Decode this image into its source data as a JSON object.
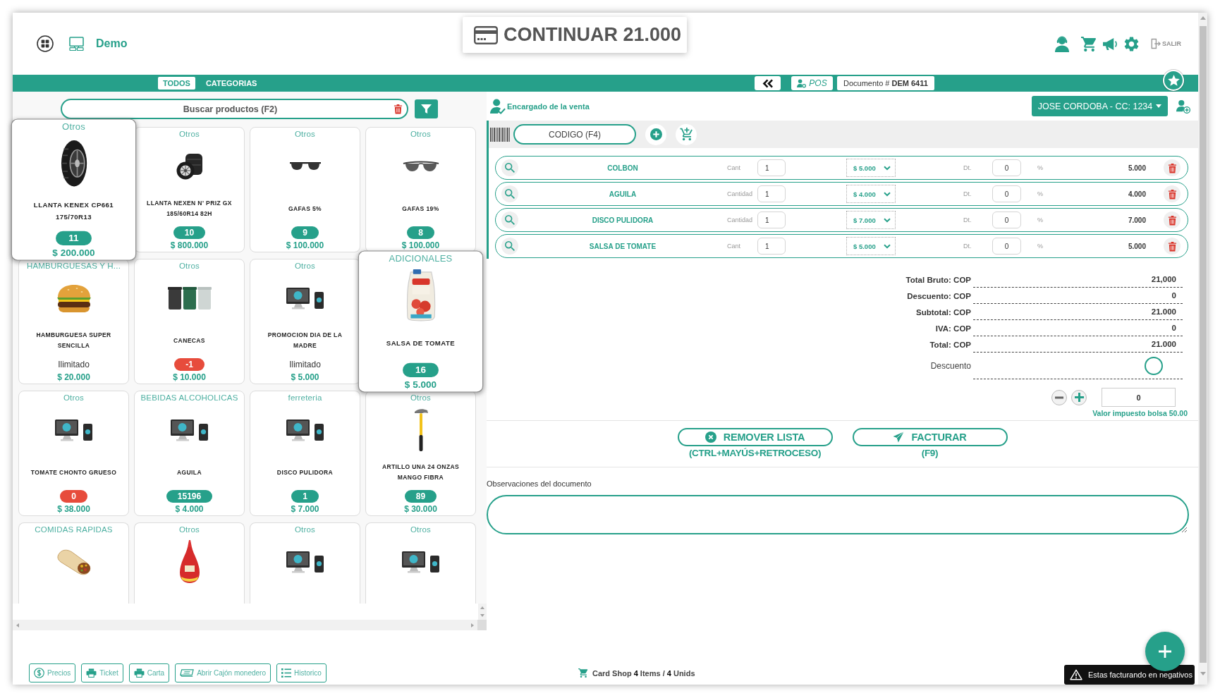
{
  "header": {
    "brand": "Demo",
    "checkout": "CONTINUAR 21.000",
    "logout": {
      "label": "SALIR",
      "disabled": true
    }
  },
  "nav": {
    "tabs": [
      {
        "label": "TODOS",
        "selected": true
      },
      {
        "label": "CATEGORIAS",
        "selected": false
      }
    ],
    "mode": "POS",
    "document": "Documento # **DEM 6411**"
  },
  "search": {
    "placeholder": "Buscar productos (F2)"
  },
  "products": [
    {
      "category": "Otros",
      "kind": "tire",
      "name": "LLANTA KENEX CP661 175/70R13",
      "stock": {
        "kind": "badge",
        "value": "11",
        "color": "#26a08a"
      },
      "price": "$ 200.000",
      "raised": true
    },
    {
      "category": "Otros",
      "kind": "wheel",
      "name": "LLANTA NEXEN N' PRIZ GX 185/60R14 82H",
      "stock": {
        "kind": "badge",
        "value": "10",
        "color": "#26a08a"
      },
      "price": "$ 800.000",
      "raised": false
    },
    {
      "category": "Otros",
      "kind": "sunglasses",
      "name": "GAFAS 5%",
      "stock": {
        "kind": "badge",
        "value": "9",
        "color": "#26a08a"
      },
      "price": "$ 100.000",
      "raised": false
    },
    {
      "category": "Otros",
      "kind": "sportglasses",
      "name": "GAFAS 19%",
      "stock": {
        "kind": "badge",
        "value": "8",
        "color": "#26a08a"
      },
      "price": "$ 100.000",
      "raised": false
    },
    {
      "category": "HAMBURGUESAS Y H...",
      "kind": "burger",
      "name": "HAMBURGUESA SUPER SENCILLA",
      "stock": {
        "kind": "text",
        "value": "Ilimitado"
      },
      "price": "$ 20.000",
      "raised": false
    },
    {
      "category": "Otros",
      "kind": "bins",
      "name": "CANECAS",
      "stock": {
        "kind": "badge",
        "value": "-1",
        "color": "#e74c3c"
      },
      "price": "$ 10.000",
      "raised": false
    },
    {
      "category": "Otros",
      "kind": "devices",
      "name": "PROMOCION DIA DE LA MADRE",
      "stock": {
        "kind": "text",
        "value": "Ilimitado"
      },
      "price": "$ 5.000",
      "raised": false
    },
    {
      "category": "ADICIONALES",
      "kind": "pouch",
      "name": "SALSA DE TOMATE",
      "stock": {
        "kind": "badge",
        "value": "16",
        "color": "#26a08a"
      },
      "price": "$ 5.000",
      "raised": true
    },
    {
      "category": "Otros",
      "kind": "devices",
      "name": "TOMATE CHONTO GRUESO",
      "stock": {
        "kind": "badge",
        "value": "0",
        "color": "#e74c3c"
      },
      "price": "$ 38.000",
      "raised": false
    },
    {
      "category": "BEBIDAS ALCOHOLICAS",
      "kind": "devices",
      "name": "AGUILA",
      "stock": {
        "kind": "badge",
        "value": "15196",
        "color": "#26a08a"
      },
      "price": "$ 4.000",
      "raised": false
    },
    {
      "category": "ferreteria",
      "kind": "devices",
      "name": "DISCO PULIDORA",
      "stock": {
        "kind": "badge",
        "value": "1",
        "color": "#26a08a"
      },
      "price": "$ 7.000",
      "raised": false
    },
    {
      "category": "Otros",
      "kind": "hammer",
      "name": "ARTILLO UNA 24 ONZAS MANGO FIBRA",
      "stock": {
        "kind": "badge",
        "value": "89",
        "color": "#26a08a"
      },
      "price": "$ 30.000",
      "raised": false
    },
    {
      "category": "COMIDAS RAPIDAS",
      "kind": "burrito",
      "raised": false
    },
    {
      "category": "Otros",
      "kind": "bottle",
      "raised": false
    },
    {
      "category": "Otros",
      "kind": "devices",
      "raised": false
    },
    {
      "category": "Otros",
      "kind": "devices",
      "raised": false
    }
  ],
  "sale": {
    "seller_label": "Encargado de la venta",
    "seller": "JOSE CORDOBA - CC: 1234"
  },
  "scan": {
    "placeholder": "CODIGO (F4)"
  },
  "lines": [
    {
      "name": "COLBON",
      "qty_label": "Cant",
      "qty": "1",
      "price": "$ 5.000",
      "discount_label": "Dt.",
      "discount": "0",
      "percent": "%",
      "total": "5.000"
    },
    {
      "name": "AGUILA",
      "qty_label": "Cantidad",
      "qty": "1",
      "price": "$ 4.000",
      "discount_label": "Dt.",
      "discount": "0",
      "percent": "%",
      "total": "4.000"
    },
    {
      "name": "DISCO PULIDORA",
      "qty_label": "Cantidad",
      "qty": "1",
      "price": "$ 7.000",
      "discount_label": "Dt.",
      "discount": "0",
      "percent": "%",
      "total": "7.000"
    },
    {
      "name": "SALSA DE TOMATE",
      "qty_label": "Cant",
      "qty": "1",
      "price": "$ 5.000",
      "discount_label": "Dt.",
      "discount": "0",
      "percent": "%",
      "total": "5.000"
    }
  ],
  "totals": [
    {
      "label": "Total Bruto: COP",
      "value": "21,000"
    },
    {
      "label": "Descuento: COP",
      "value": "0"
    },
    {
      "label": "Subtotal: COP",
      "value": "21.000"
    },
    {
      "label": "IVA: COP",
      "value": "0"
    },
    {
      "label": "Total: COP",
      "value": "21.000"
    }
  ],
  "discount_toggle": {
    "label": "Descuento",
    "on": false
  },
  "bag": {
    "value": "0",
    "note": "Valor impuesto bolsa 50.00"
  },
  "actions": [
    {
      "kind": "remove",
      "label": "REMOVER LISTA",
      "shortcut": "(CTRL+MAYÚS+RETROCESO)"
    },
    {
      "kind": "invoice",
      "label": "FACTURAR",
      "shortcut": "(F9)"
    }
  ],
  "notes": {
    "label": "Observaciones del documento"
  },
  "footer": {
    "buttons": [
      {
        "kind": "prices",
        "label": "Precios"
      },
      {
        "kind": "ticket",
        "label": "Ticket"
      },
      {
        "kind": "letter",
        "label": "Carta"
      },
      {
        "kind": "drawer",
        "label": "Abrir Cajón monedero"
      },
      {
        "kind": "history",
        "label": "Historico"
      }
    ],
    "summary": "Card Shop **4** Items / **4** Unids"
  },
  "toast": "Estas facturando en negativos"
}
